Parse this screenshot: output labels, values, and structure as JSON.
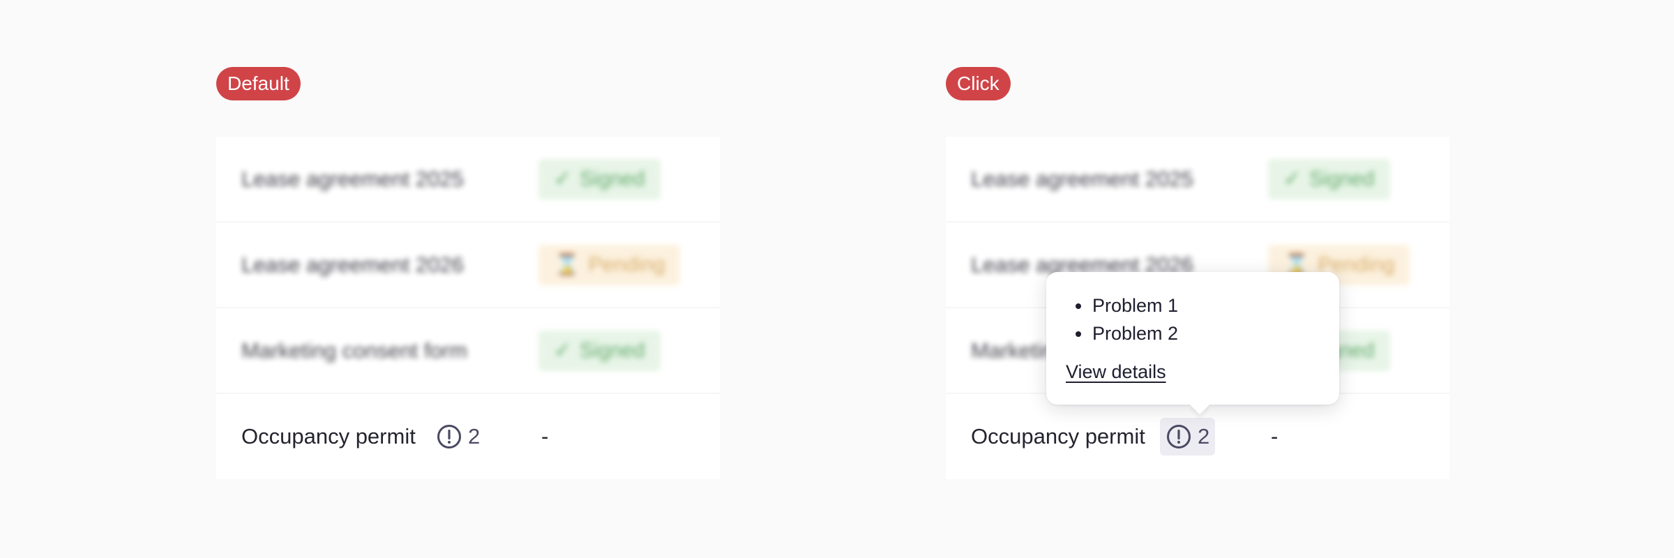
{
  "panels": [
    {
      "state_label": "Default",
      "rows": [
        {
          "name": "Lease agreement 2025",
          "status": "Signed",
          "status_icon": "✓"
        },
        {
          "name": "Lease agreement 2026",
          "status": "Pending",
          "status_icon": "⌛"
        },
        {
          "name": "Marketing consent form",
          "status": "Signed",
          "status_icon": "✓"
        },
        {
          "name": "Occupancy permit",
          "issue_count": "2",
          "status": "-"
        }
      ]
    },
    {
      "state_label": "Click",
      "rows": [
        {
          "name": "Lease agreement 2025",
          "status": "Signed",
          "status_icon": "✓"
        },
        {
          "name": "Lease agreement 2026",
          "status": "Pending",
          "status_icon": "⌛"
        },
        {
          "name": "Marketing consent form",
          "status": "Signed",
          "status_icon": "✓"
        },
        {
          "name": "Occupancy permit",
          "issue_count": "2",
          "status": "-"
        }
      ],
      "popover": {
        "problems": [
          "Problem 1",
          "Problem 2"
        ],
        "link_label": "View details"
      }
    }
  ],
  "icons": {
    "signed": "check-icon",
    "pending": "hourglass-icon",
    "issue": "exclamation-circle-icon"
  },
  "colors": {
    "state_badge": "#d04448",
    "signed_bg": "#e3f3e3",
    "signed_fg": "#4d9f58",
    "pending_bg": "#fcefd9",
    "pending_fg": "#d3a052",
    "issue_fg": "#4a4a63",
    "issue_active_bg": "#ececf2"
  }
}
